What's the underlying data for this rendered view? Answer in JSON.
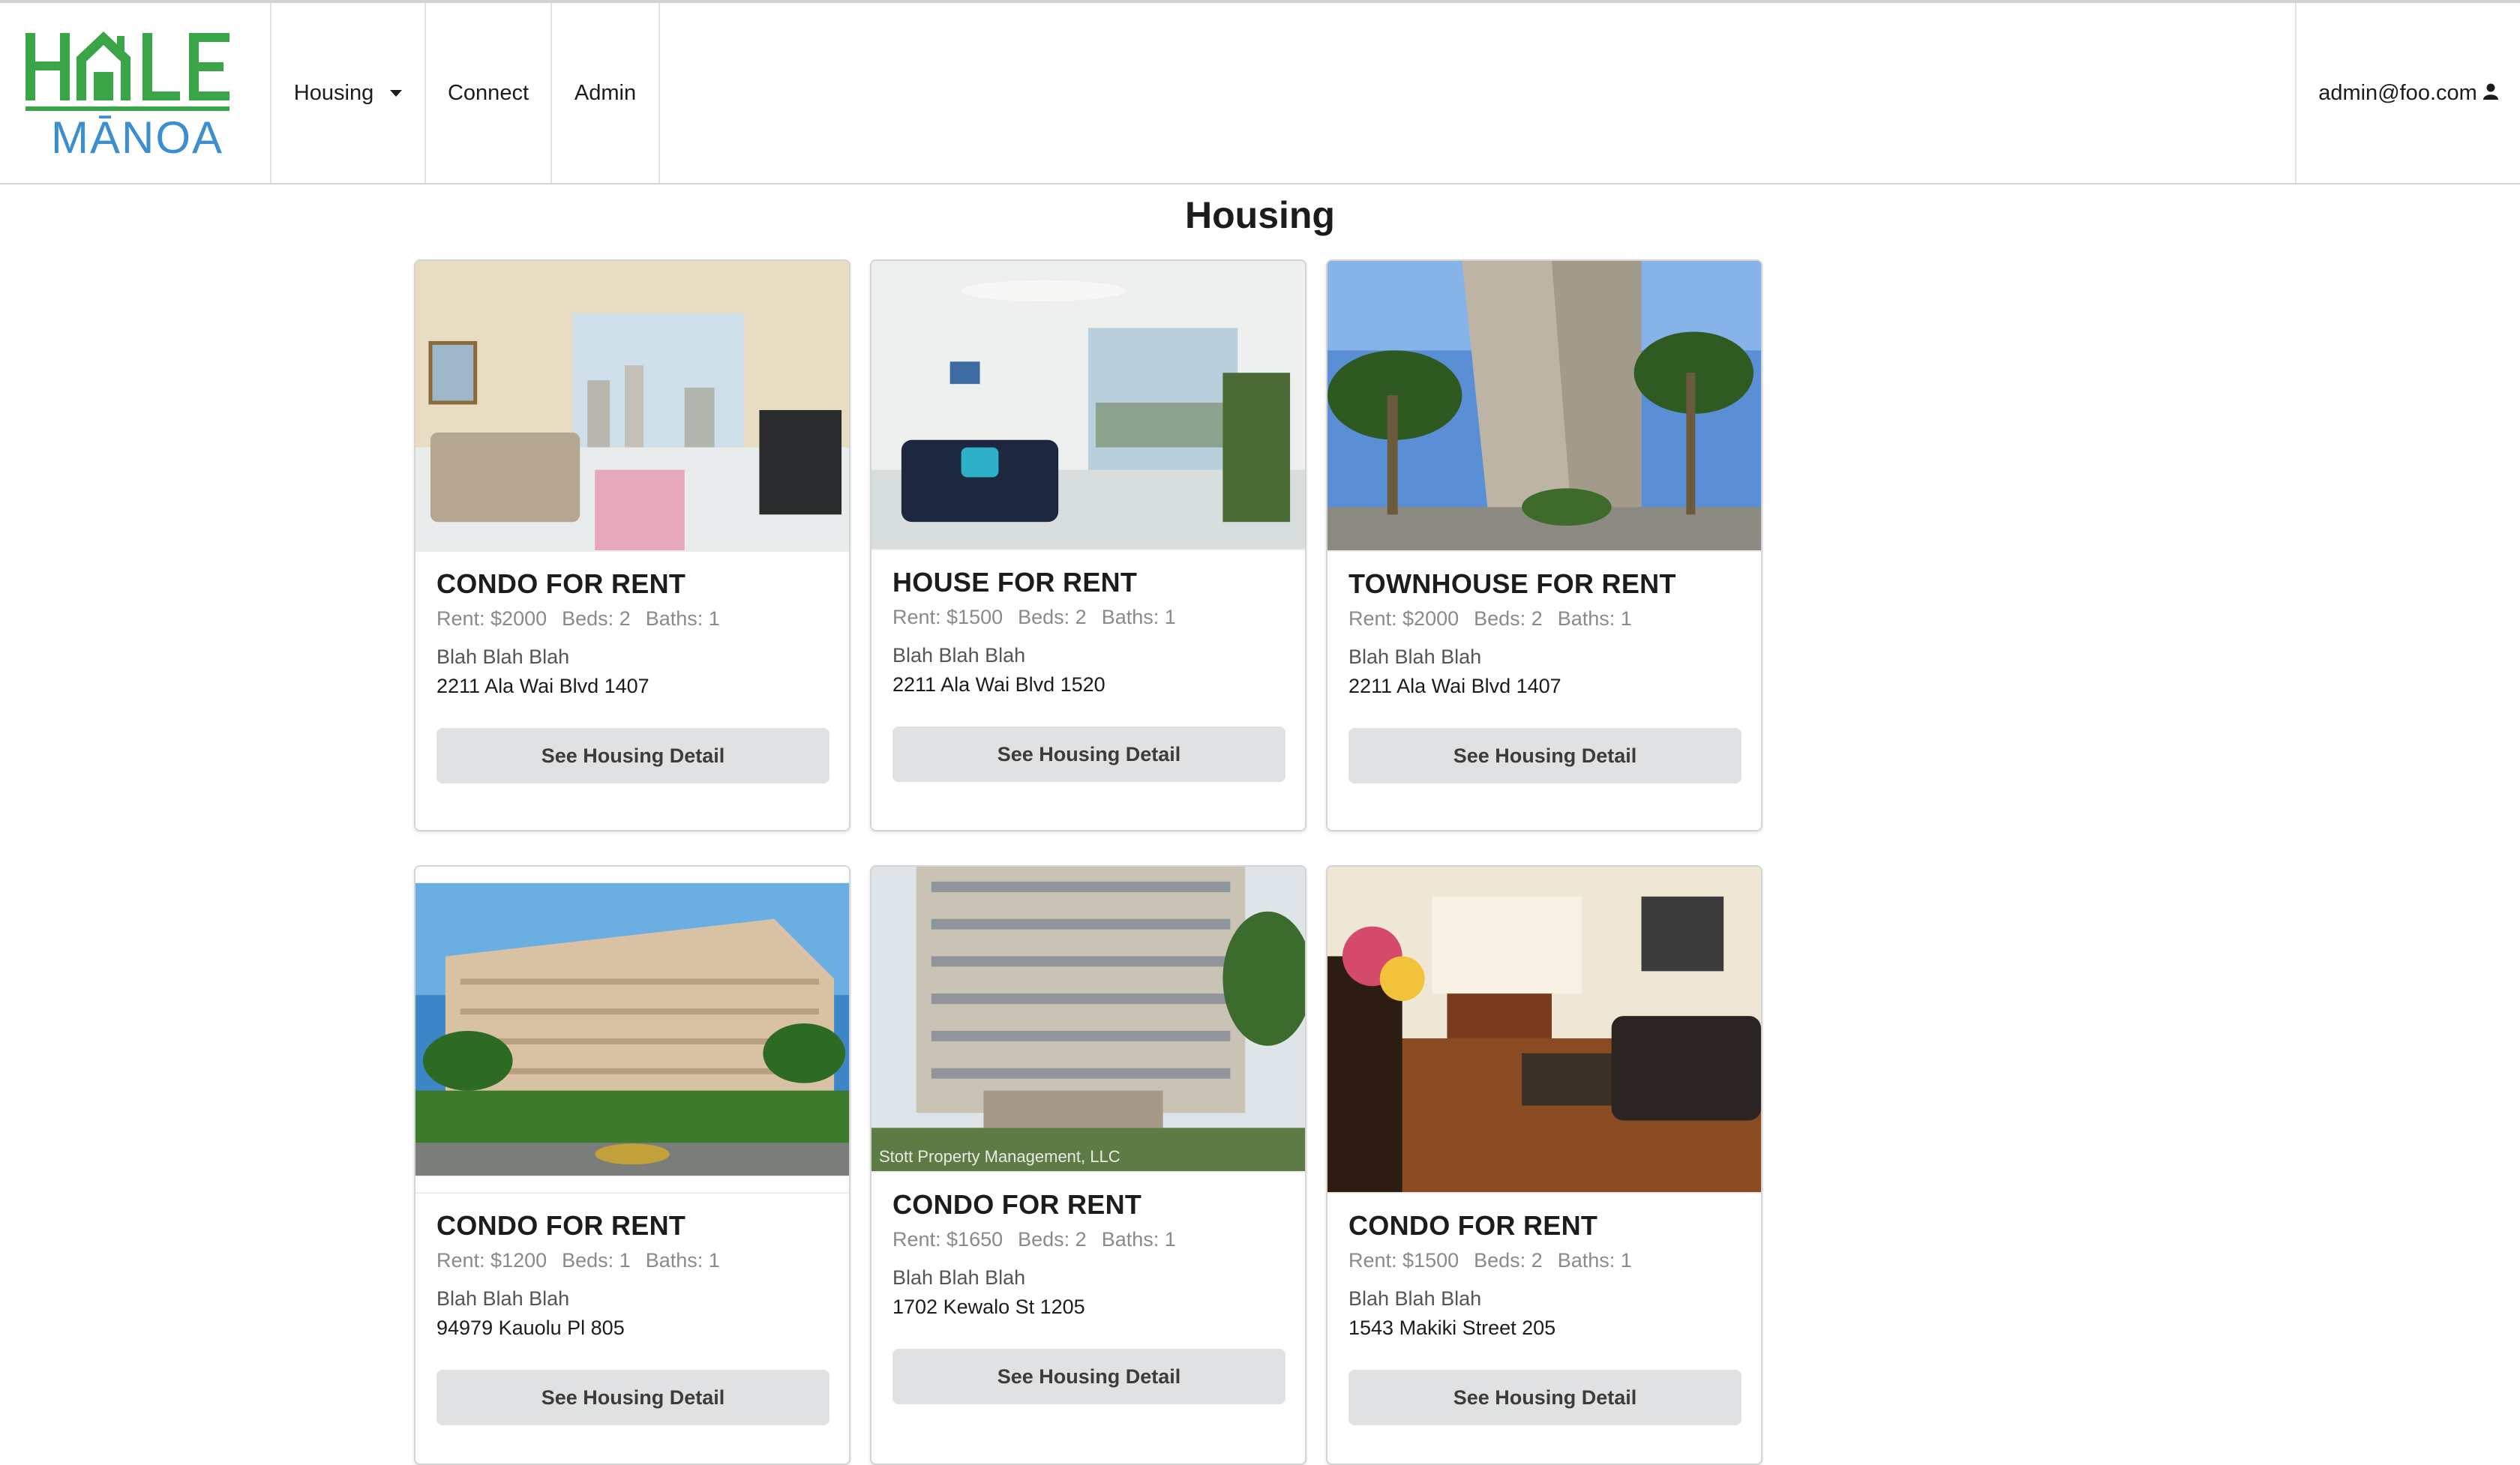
{
  "app": {
    "brand_top": "HALE",
    "brand_bottom": "MĀNOA",
    "brand_colors": {
      "green": "#3aa547",
      "blue": "#3b8fd1"
    }
  },
  "nav": {
    "housing": "Housing",
    "connect": "Connect",
    "admin": "Admin",
    "user_email": "admin@foo.com",
    "user_icon": "user-icon",
    "housing_dropdown_icon": "chevron-down-icon"
  },
  "page": {
    "title": "Housing"
  },
  "listings": [
    {
      "title": "CONDO FOR RENT",
      "rent": "Rent: $2000",
      "beds": "Beds: 2",
      "baths": "Baths: 1",
      "description": "Blah Blah Blah",
      "address": "2211 Ala Wai Blvd 1407",
      "button": "See Housing Detail",
      "image": "living-room-photo"
    },
    {
      "title": "HOUSE FOR RENT",
      "rent": "Rent: $1500",
      "beds": "Beds: 2",
      "baths": "Baths: 1",
      "description": "Blah Blah Blah",
      "address": "2211 Ala Wai Blvd 1520",
      "button": "See Housing Detail",
      "image": "living-room-photo"
    },
    {
      "title": "TOWNHOUSE FOR RENT",
      "rent": "Rent: $2000",
      "beds": "Beds: 2",
      "baths": "Baths: 1",
      "description": "Blah Blah Blah",
      "address": "2211 Ala Wai Blvd 1407",
      "button": "See Housing Detail",
      "image": "building-photo"
    },
    {
      "title": "CONDO FOR RENT",
      "rent": "Rent: $1200",
      "beds": "Beds: 1",
      "baths": "Baths: 1",
      "description": "Blah Blah Blah",
      "address": "94979 Kauolu Pl 805",
      "button": "See Housing Detail",
      "image": "building-photo"
    },
    {
      "title": "CONDO FOR RENT",
      "rent": "Rent: $1650",
      "beds": "Beds: 2",
      "baths": "Baths: 1",
      "description": "Blah Blah Blah",
      "address": "1702 Kewalo St 1205",
      "button": "See Housing Detail",
      "image": "building-photo",
      "watermark": "Stott Property Management, LLC"
    },
    {
      "title": "CONDO FOR RENT",
      "rent": "Rent: $1500",
      "beds": "Beds: 2",
      "baths": "Baths: 1",
      "description": "Blah Blah Blah",
      "address": "1543 Makiki Street 205",
      "button": "See Housing Detail",
      "image": "living-room-photo"
    }
  ]
}
